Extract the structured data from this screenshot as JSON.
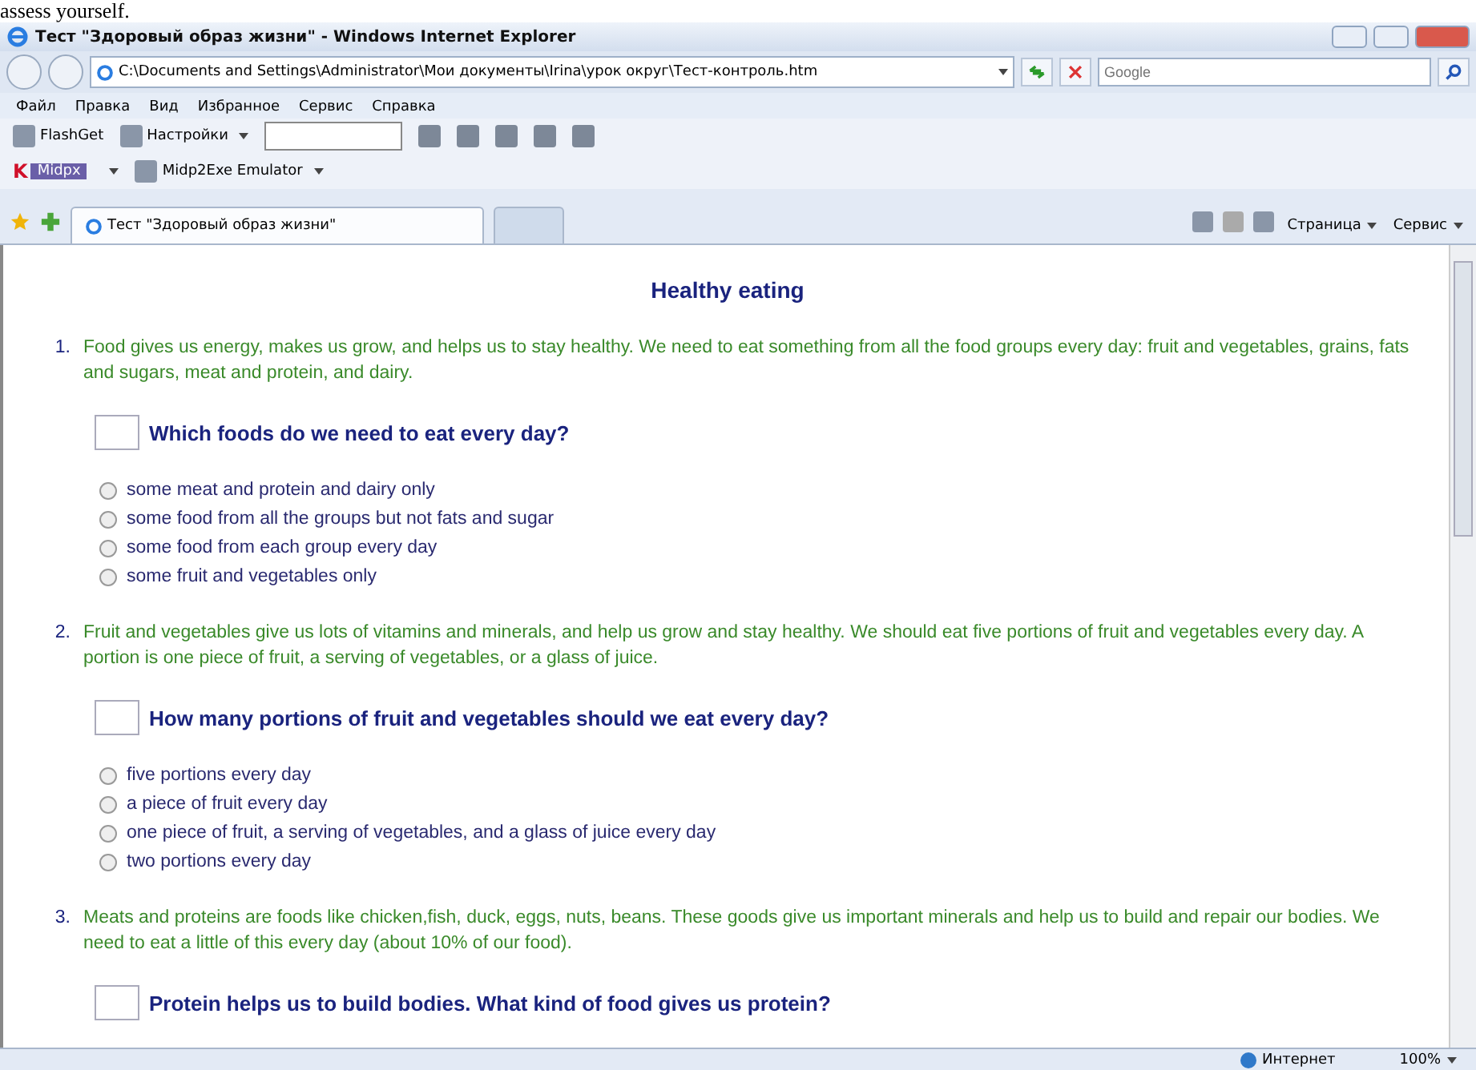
{
  "caption": "assess yourself.",
  "window": {
    "title": "Тест \"Здоровый образ жизни\" - Windows Internet Explorer"
  },
  "address_bar": {
    "value": "C:\\Documents and Settings\\Administrator\\Мои документы\\Irina\\урок округ\\Тест-контроль.htm"
  },
  "search": {
    "placeholder": "Google"
  },
  "menu": [
    "Файл",
    "Правка",
    "Вид",
    "Избранное",
    "Сервис",
    "Справка"
  ],
  "toolbar": {
    "flashget": "FlashGet",
    "settings": "Настройки"
  },
  "links_bar": {
    "logo_mark": "K",
    "midpx": "Midpx",
    "emulator": "Midp2Exe Emulator"
  },
  "tabs": [
    {
      "label": "Тест \"Здоровый образ жизни\"",
      "selected": true
    },
    {
      "selected": false
    }
  ],
  "command_bar": {
    "page": "Страница",
    "tools": "Сервис"
  },
  "page": {
    "heading": "Healthy eating",
    "sections": [
      {
        "number": "1.",
        "text": "Food gives us energy, makes us grow, and helps us to stay healthy. We need to eat something from all the food groups every day: fruit and vegetables, grains, fats and sugars, meat and protein, and dairy.",
        "question": "Which foods do we need to eat every day?",
        "options": [
          {
            "label": "some meat and protein and dairy only",
            "selected": false
          },
          {
            "label": "some food from all the groups but not fats and sugar",
            "selected": false
          },
          {
            "label": "some food from each group every day",
            "selected": false
          },
          {
            "label": "some fruit and vegetables only",
            "selected": false
          }
        ]
      },
      {
        "number": "2.",
        "text": "Fruit and vegetables give us lots of vitamins and minerals, and help us grow and stay healthy. We should eat five portions of fruit and vegetables every day. A portion is one piece of fruit, a serving of vegetables, or a glass of juice.",
        "question": "How many portions of fruit and vegetables should we eat every day?",
        "options": [
          {
            "label": "five portions every day",
            "selected": false
          },
          {
            "label": "a piece of fruit every day",
            "selected": false
          },
          {
            "label": "one piece of fruit, a serving of vegetables, and a glass of juice every day",
            "selected": false
          },
          {
            "label": "two portions every day",
            "selected": false
          }
        ]
      },
      {
        "number": "3.",
        "text": "Meats and proteins are foods like chicken,fish, duck, eggs, nuts, beans. These goods give us important minerals and help us to build and repair our bodies. We need to eat a little of this every day (about 10% of our food).",
        "question": "Protein helps us to build bodies. What kind of food gives us protein?"
      }
    ]
  },
  "status_bar": {
    "zone": "Интернет",
    "zoom": "100%"
  }
}
